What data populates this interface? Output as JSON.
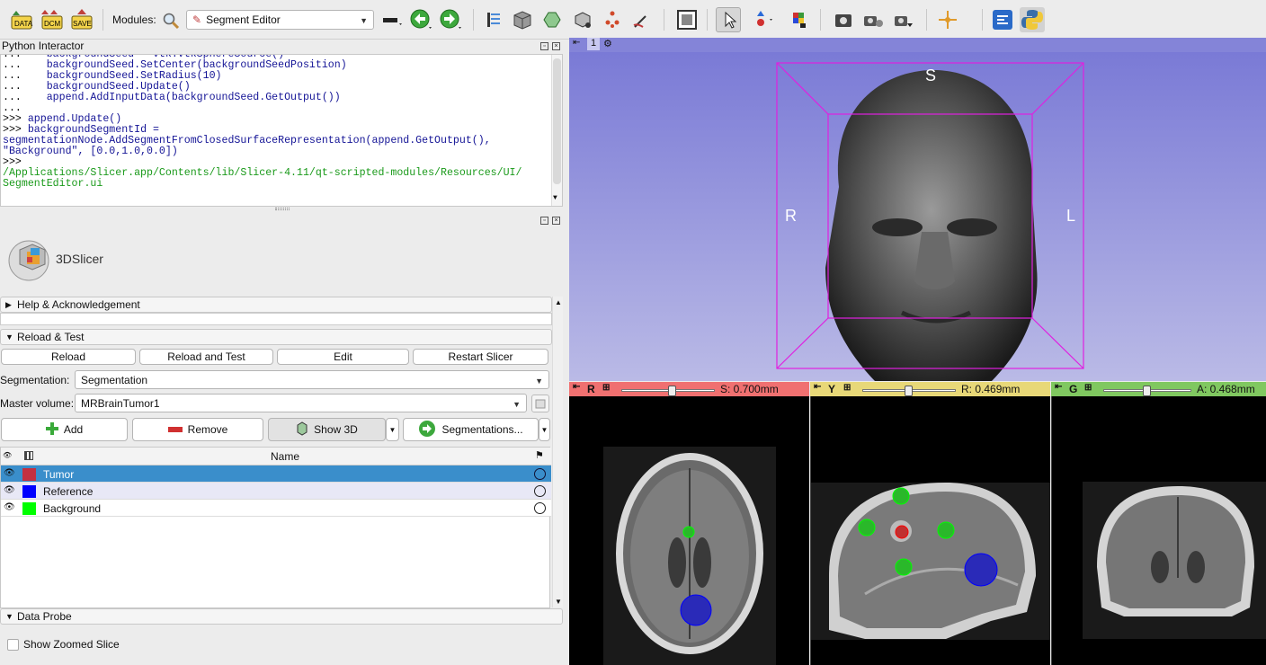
{
  "toolbar": {
    "data_label": "DATA",
    "dcm_label": "DCM",
    "save_label": "SAVE",
    "modules_label": "Modules:",
    "module_selected": "Segment Editor",
    "icons": [
      "data-icon",
      "dcm-icon",
      "save-icon",
      "module-search-icon",
      "module-history-icon",
      "back-arrow-icon",
      "forward-arrow-icon",
      "extensions-icon",
      "volume-icon",
      "model-icon",
      "markups-icon",
      "transform-icon",
      "crosshair-tools-icon",
      "layout-icon",
      "select-pointer-icon",
      "place-fiducial-icon",
      "colors-icon",
      "screenshot-icon",
      "scene-views-icon",
      "record-icon",
      "crosshair-icon",
      "extension-manager-icon",
      "python-icon"
    ]
  },
  "python": {
    "title": "Python Interactor",
    "lines": [
      {
        "p": "...",
        "t": "    backgroundSeed = vtk.vtkSphereSource()",
        "c": "blue"
      },
      {
        "p": "...",
        "t": "    backgroundSeed.SetCenter(backgroundSeedPosition)",
        "c": "blue"
      },
      {
        "p": "...",
        "t": "    backgroundSeed.SetRadius(10)",
        "c": "blue"
      },
      {
        "p": "...",
        "t": "    backgroundSeed.Update()",
        "c": "blue"
      },
      {
        "p": "...",
        "t": "    append.AddInputData(backgroundSeed.GetOutput())",
        "c": "blue"
      },
      {
        "p": "...",
        "t": "",
        "c": "blue"
      },
      {
        "p": ">>>",
        "t": " append.Update()",
        "c": "blue"
      },
      {
        "p": ">>>",
        "t": " backgroundSegmentId =",
        "c": "blue"
      },
      {
        "p": "",
        "t": "segmentationNode.AddSegmentFromClosedSurfaceRepresentation(append.GetOutput(),",
        "c": "blue"
      },
      {
        "p": "",
        "t": "\"Background\", [0.0,1.0,0.0])",
        "c": "blue"
      },
      {
        "p": ">>>",
        "t": "",
        "c": "blue"
      },
      {
        "p": "",
        "t": "/Applications/Slicer.app/Contents/lib/Slicer-4.11/qt-scripted-modules/Resources/UI/",
        "c": "green"
      },
      {
        "p": "",
        "t": "SegmentEditor.ui",
        "c": "green"
      }
    ]
  },
  "logo_text": "3DSlicer",
  "sections": {
    "help": "Help & Acknowledgement",
    "reload": "Reload & Test",
    "data_probe": "Data Probe"
  },
  "reload_buttons": [
    "Reload",
    "Reload and Test",
    "Edit",
    "Restart Slicer"
  ],
  "segmentation": {
    "label": "Segmentation:",
    "value": "Segmentation"
  },
  "master_volume": {
    "label": "Master volume:",
    "value": "MRBrainTumor1"
  },
  "seg_buttons": {
    "add": "Add",
    "remove": "Remove",
    "show3d": "Show 3D",
    "segmentations": "Segmentations..."
  },
  "table": {
    "header_name": "Name",
    "rows": [
      {
        "name": "Tumor",
        "color": "#c43040",
        "selected": true
      },
      {
        "name": "Reference",
        "color": "#0000ff",
        "selected": false
      },
      {
        "name": "Background",
        "color": "#00ff00",
        "selected": false
      }
    ]
  },
  "show_zoomed_slice": "Show Zoomed Slice",
  "view3d": {
    "number": "1",
    "S": "S",
    "R": "R",
    "L": "L"
  },
  "slices": [
    {
      "letter": "R",
      "value": "S: 0.700mm",
      "color": "#f07070",
      "level": 0.55
    },
    {
      "letter": "Y",
      "value": "R: 0.469mm",
      "color": "#e8d878",
      "level": 0.5
    },
    {
      "letter": "G",
      "value": "A: 0.468mm",
      "color": "#80c860",
      "level": 0.5
    }
  ]
}
